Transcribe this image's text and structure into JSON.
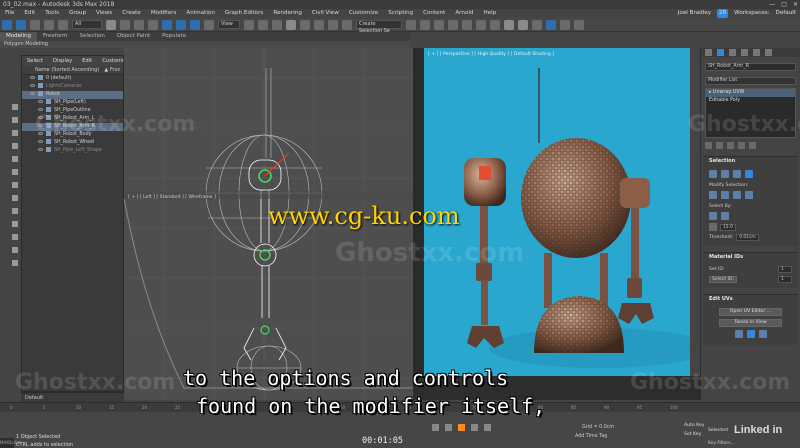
{
  "window": {
    "title": "03_02.max - Autodesk 3ds Max 2018",
    "minimize": "—",
    "maximize": "□",
    "close": "✕"
  },
  "menu": {
    "items": [
      "File",
      "Edit",
      "Tools",
      "Group",
      "Views",
      "Create",
      "Modifiers",
      "Animation",
      "Graph Editors",
      "Rendering",
      "Civil View",
      "Customize",
      "Scripting",
      "Content",
      "Arnold",
      "Help"
    ],
    "user": "Joel Bradley",
    "badge": "28",
    "workspaces_label": "Workspaces:",
    "workspace": "Default"
  },
  "toolbar": {
    "filter": "All",
    "view": "View",
    "selection_set": "Create Selection Se"
  },
  "ribbon": {
    "tabs": [
      "Modeling",
      "Freeform",
      "Selection",
      "Object Paint",
      "Populate"
    ],
    "active": "Modeling",
    "sub": "Polygon Modeling"
  },
  "explorer": {
    "tabs": [
      "Select",
      "Display",
      "Edit",
      "Customize"
    ],
    "header": "Name (Sorted Ascending)",
    "header_right": "▲ Froz",
    "items": [
      {
        "label": "0 (default)",
        "state": "normal"
      },
      {
        "label": "LightsCameras",
        "state": "dim"
      },
      {
        "label": "Robot",
        "state": "sel"
      },
      {
        "label": "SH_Pipe(Left)",
        "state": "normal"
      },
      {
        "label": "SH_PipeOutline",
        "state": "normal"
      },
      {
        "label": "SH_Robot_Arm_L",
        "state": "normal"
      },
      {
        "label": "SH_Robot_Arm_R",
        "state": "sel"
      },
      {
        "label": "SH_Robot_Body",
        "state": "normal"
      },
      {
        "label": "SH_Robot_Wheel",
        "state": "normal"
      },
      {
        "label": "SH_Pipe_Left_Shape",
        "state": "dim"
      }
    ],
    "layer": "Default"
  },
  "viewports": {
    "left_label": "[ + ] [ Left ] [ Standard ] [ Wireframe ]",
    "right_label": "[ + ] [ Perspective ] [ High Quality ] [ Default Shading ]"
  },
  "command_panel": {
    "object_name": "SH_Robot_Arm_R",
    "modifier_list": "Modifier List",
    "stack": [
      {
        "label": "▸ Unwrap UVW",
        "selected": true
      },
      {
        "label": "Editable Poly",
        "selected": false
      }
    ],
    "selection": {
      "title": "Selection",
      "modify_selection": "Modify Selection:",
      "select_by": "Select By:",
      "angle_value": "15.0",
      "threshold_label": "Threshold:",
      "threshold_value": "0.01cm"
    },
    "material_ids": {
      "title": "Material IDs",
      "set_id": "Set ID:",
      "set_id_value": "1",
      "select_id": "Select ID:",
      "select_id_value": "1"
    },
    "edit_uvs": {
      "title": "Edit UVs",
      "open_editor": "Open UV Editor ...",
      "tweak": "Tweak In View"
    }
  },
  "status": {
    "frame_ticks": [
      "0",
      "5",
      "10",
      "15",
      "20",
      "25",
      "30",
      "35",
      "40",
      "45",
      "50",
      "55",
      "60",
      "65",
      "70",
      "75",
      "80",
      "85",
      "90",
      "95",
      "100"
    ],
    "objects_selected": "1 Object Selected",
    "hint": "CTRL adds to selection",
    "maxscript": "MAXScript Mi",
    "grid": "Grid = 0.0cm",
    "add_time_tag": "Add Time Tag",
    "auto_key": "Auto Key",
    "set_key": "Set Key",
    "selected": "Selected",
    "key_filters": "Key Filters...",
    "timecode": "00:01:05",
    "brand": "Linked in"
  },
  "subtitles": {
    "line1": "to the options and controls",
    "line2": "found on the modifier itself,"
  },
  "watermarks": {
    "ghostxx": "Ghostxx.com",
    "center": "www.cg-ku.com"
  },
  "colors": {
    "render_bg": "#29a7cf",
    "accent": "#2f89e0",
    "play": "#ff8a1f"
  }
}
